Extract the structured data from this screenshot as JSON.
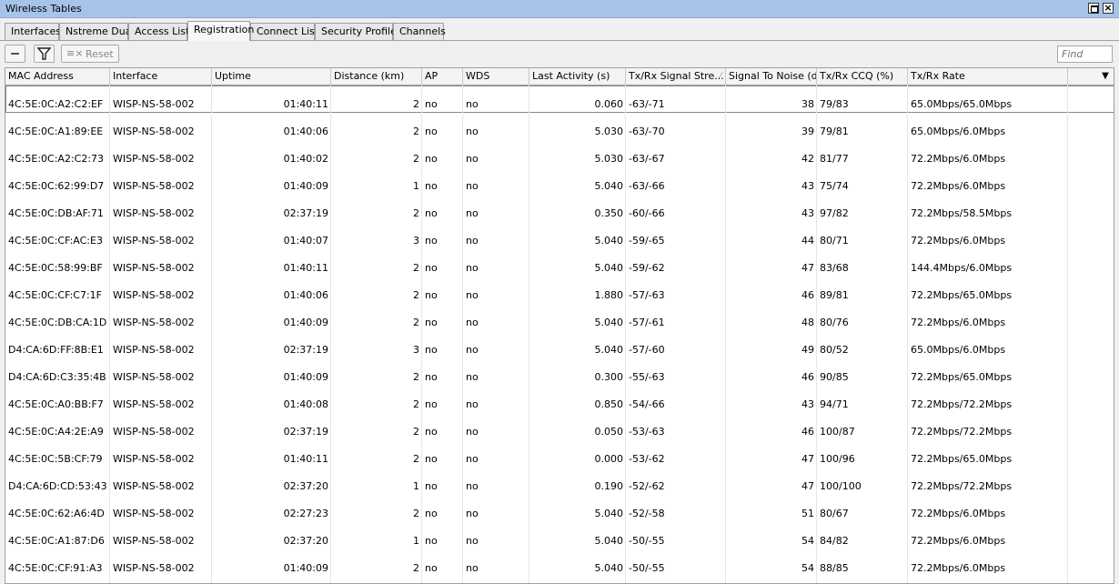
{
  "window": {
    "title": "Wireless Tables"
  },
  "tabs": [
    "Interfaces",
    "Nstreme Dual",
    "Access List",
    "Registration",
    "Connect List",
    "Security Profiles",
    "Channels"
  ],
  "active_tab": "Registration",
  "toolbar": {
    "reset_label": "Reset",
    "find_placeholder": "Find"
  },
  "columns": [
    "MAC Address",
    "Interface",
    "Uptime",
    "Distance (km)",
    "AP",
    "WDS",
    "Last Activity (s)",
    "Tx/Rx Signal Stre...",
    "Signal To Noise (d...",
    "Tx/Rx CCQ (%)",
    "Tx/Rx Rate"
  ],
  "rows": [
    {
      "mac": "4C:5E:0C:A2:C2:EF",
      "iface": "WISP-NS-58-002",
      "uptime": "01:40:11",
      "distance": "2",
      "ap": "no",
      "wds": "no",
      "last": "0.060",
      "signal": "-63/-71",
      "snr": "38",
      "ccq": "79/83",
      "rate": "65.0Mbps/65.0Mbps"
    },
    {
      "mac": "4C:5E:0C:A1:89:EE",
      "iface": "WISP-NS-58-002",
      "uptime": "01:40:06",
      "distance": "2",
      "ap": "no",
      "wds": "no",
      "last": "5.030",
      "signal": "-63/-70",
      "snr": "39",
      "ccq": "79/81",
      "rate": "65.0Mbps/6.0Mbps"
    },
    {
      "mac": "4C:5E:0C:A2:C2:73",
      "iface": "WISP-NS-58-002",
      "uptime": "01:40:02",
      "distance": "2",
      "ap": "no",
      "wds": "no",
      "last": "5.030",
      "signal": "-63/-67",
      "snr": "42",
      "ccq": "81/77",
      "rate": "72.2Mbps/6.0Mbps"
    },
    {
      "mac": "4C:5E:0C:62:99:D7",
      "iface": "WISP-NS-58-002",
      "uptime": "01:40:09",
      "distance": "1",
      "ap": "no",
      "wds": "no",
      "last": "5.040",
      "signal": "-63/-66",
      "snr": "43",
      "ccq": "75/74",
      "rate": "72.2Mbps/6.0Mbps"
    },
    {
      "mac": "4C:5E:0C:DB:AF:71",
      "iface": "WISP-NS-58-002",
      "uptime": "02:37:19",
      "distance": "2",
      "ap": "no",
      "wds": "no",
      "last": "0.350",
      "signal": "-60/-66",
      "snr": "43",
      "ccq": "97/82",
      "rate": "72.2Mbps/58.5Mbps"
    },
    {
      "mac": "4C:5E:0C:CF:AC:E3",
      "iface": "WISP-NS-58-002",
      "uptime": "01:40:07",
      "distance": "3",
      "ap": "no",
      "wds": "no",
      "last": "5.040",
      "signal": "-59/-65",
      "snr": "44",
      "ccq": "80/71",
      "rate": "72.2Mbps/6.0Mbps"
    },
    {
      "mac": "4C:5E:0C:58:99:BF",
      "iface": "WISP-NS-58-002",
      "uptime": "01:40:11",
      "distance": "2",
      "ap": "no",
      "wds": "no",
      "last": "5.040",
      "signal": "-59/-62",
      "snr": "47",
      "ccq": "83/68",
      "rate": "144.4Mbps/6.0Mbps"
    },
    {
      "mac": "4C:5E:0C:CF:C7:1F",
      "iface": "WISP-NS-58-002",
      "uptime": "01:40:06",
      "distance": "2",
      "ap": "no",
      "wds": "no",
      "last": "1.880",
      "signal": "-57/-63",
      "snr": "46",
      "ccq": "89/81",
      "rate": "72.2Mbps/65.0Mbps"
    },
    {
      "mac": "4C:5E:0C:DB:CA:1D",
      "iface": "WISP-NS-58-002",
      "uptime": "01:40:09",
      "distance": "2",
      "ap": "no",
      "wds": "no",
      "last": "5.040",
      "signal": "-57/-61",
      "snr": "48",
      "ccq": "80/76",
      "rate": "72.2Mbps/6.0Mbps"
    },
    {
      "mac": "D4:CA:6D:FF:8B:E1",
      "iface": "WISP-NS-58-002",
      "uptime": "02:37:19",
      "distance": "3",
      "ap": "no",
      "wds": "no",
      "last": "5.040",
      "signal": "-57/-60",
      "snr": "49",
      "ccq": "80/52",
      "rate": "65.0Mbps/6.0Mbps"
    },
    {
      "mac": "D4:CA:6D:C3:35:4B",
      "iface": "WISP-NS-58-002",
      "uptime": "01:40:09",
      "distance": "2",
      "ap": "no",
      "wds": "no",
      "last": "0.300",
      "signal": "-55/-63",
      "snr": "46",
      "ccq": "90/85",
      "rate": "72.2Mbps/65.0Mbps"
    },
    {
      "mac": "4C:5E:0C:A0:BB:F7",
      "iface": "WISP-NS-58-002",
      "uptime": "01:40:08",
      "distance": "2",
      "ap": "no",
      "wds": "no",
      "last": "0.850",
      "signal": "-54/-66",
      "snr": "43",
      "ccq": "94/71",
      "rate": "72.2Mbps/72.2Mbps"
    },
    {
      "mac": "4C:5E:0C:A4:2E:A9",
      "iface": "WISP-NS-58-002",
      "uptime": "02:37:19",
      "distance": "2",
      "ap": "no",
      "wds": "no",
      "last": "0.050",
      "signal": "-53/-63",
      "snr": "46",
      "ccq": "100/87",
      "rate": "72.2Mbps/72.2Mbps"
    },
    {
      "mac": "4C:5E:0C:5B:CF:79",
      "iface": "WISP-NS-58-002",
      "uptime": "01:40:11",
      "distance": "2",
      "ap": "no",
      "wds": "no",
      "last": "0.000",
      "signal": "-53/-62",
      "snr": "47",
      "ccq": "100/96",
      "rate": "72.2Mbps/65.0Mbps"
    },
    {
      "mac": "D4:CA:6D:CD:53:43",
      "iface": "WISP-NS-58-002",
      "uptime": "02:37:20",
      "distance": "1",
      "ap": "no",
      "wds": "no",
      "last": "0.190",
      "signal": "-52/-62",
      "snr": "47",
      "ccq": "100/100",
      "rate": "72.2Mbps/72.2Mbps"
    },
    {
      "mac": "4C:5E:0C:62:A6:4D",
      "iface": "WISP-NS-58-002",
      "uptime": "02:27:23",
      "distance": "2",
      "ap": "no",
      "wds": "no",
      "last": "5.040",
      "signal": "-52/-58",
      "snr": "51",
      "ccq": "80/67",
      "rate": "72.2Mbps/6.0Mbps"
    },
    {
      "mac": "4C:5E:0C:A1:87:D6",
      "iface": "WISP-NS-58-002",
      "uptime": "02:37:20",
      "distance": "1",
      "ap": "no",
      "wds": "no",
      "last": "5.040",
      "signal": "-50/-55",
      "snr": "54",
      "ccq": "84/82",
      "rate": "72.2Mbps/6.0Mbps"
    },
    {
      "mac": "4C:5E:0C:CF:91:A3",
      "iface": "WISP-NS-58-002",
      "uptime": "01:40:09",
      "distance": "2",
      "ap": "no",
      "wds": "no",
      "last": "5.040",
      "signal": "-50/-55",
      "snr": "54",
      "ccq": "88/85",
      "rate": "72.2Mbps/6.0Mbps"
    }
  ]
}
